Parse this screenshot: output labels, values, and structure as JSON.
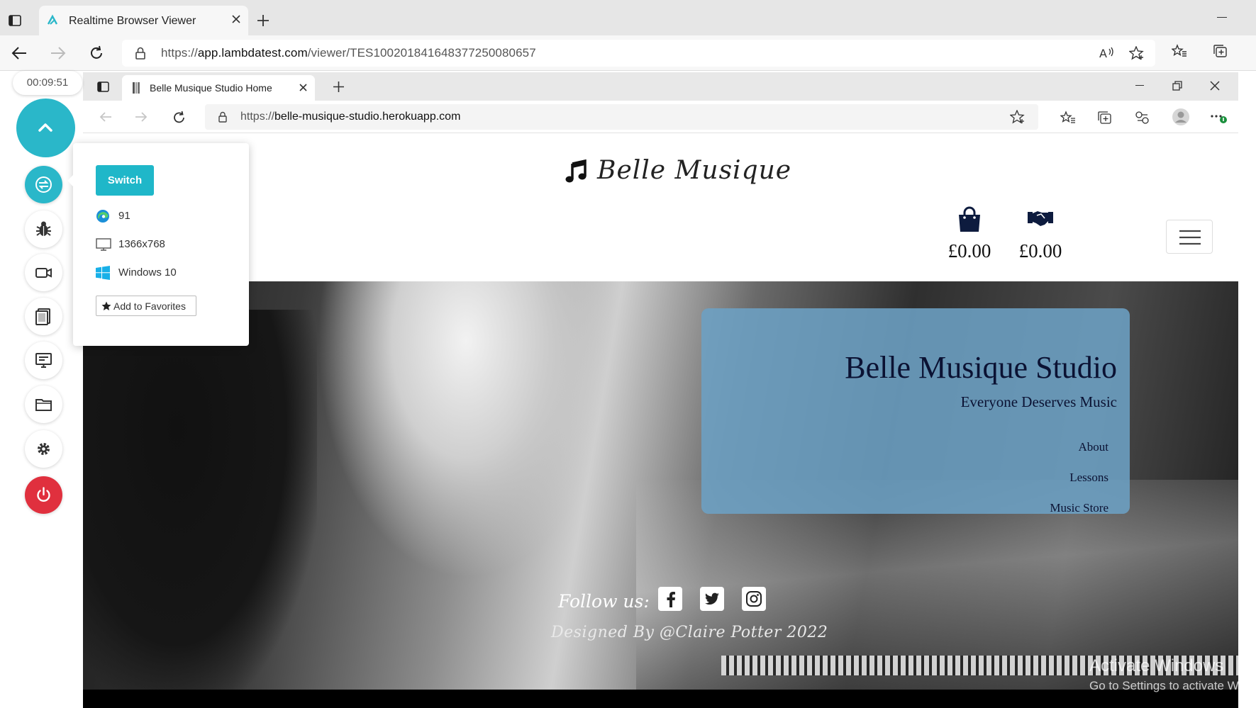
{
  "outer_browser": {
    "tab_title": "Realtime Browser Viewer",
    "url_prefix": "https://",
    "url_host": "app.lambdatest.com",
    "url_path": "/viewer/TES100201841648377250080657"
  },
  "lambdatest_panel": {
    "timer": "00:09:51",
    "switch_popup": {
      "switch_label": "Switch",
      "browser_version": "91",
      "resolution": "1366x768",
      "os": "Windows 10",
      "favorites_label": "Add to Favorites"
    },
    "tools": [
      "switch-icon",
      "bug-icon",
      "video-icon",
      "gallery-icon",
      "monitor-icon",
      "folder-icon",
      "gear-icon",
      "power-icon"
    ]
  },
  "inner_browser": {
    "tab_title": "Belle Musique Studio Home",
    "url_prefix": "https://",
    "url_host": "belle-musique-studio.herokuapp.com"
  },
  "site": {
    "brand": "Belle Musique",
    "bag_amount": "£0.00",
    "lesson_amount": "£0.00",
    "hero": {
      "title": "Belle Musique Studio",
      "tagline": "Everyone Deserves Music",
      "links": [
        "About",
        "Lessons",
        "Music Store"
      ]
    },
    "follow_label": "Follow us:",
    "socials": [
      "facebook-icon",
      "twitter-icon",
      "instagram-icon"
    ],
    "designed_by": "Designed By @Claire Potter 2022"
  },
  "watermark": {
    "line1": "Activate Windows",
    "line2": "Go to Settings to activate Windows."
  },
  "colors": {
    "accent": "#2ab7c9",
    "power": "#e0303e",
    "hero_card": "#6ca0c4",
    "hero_text": "#0b1233"
  }
}
